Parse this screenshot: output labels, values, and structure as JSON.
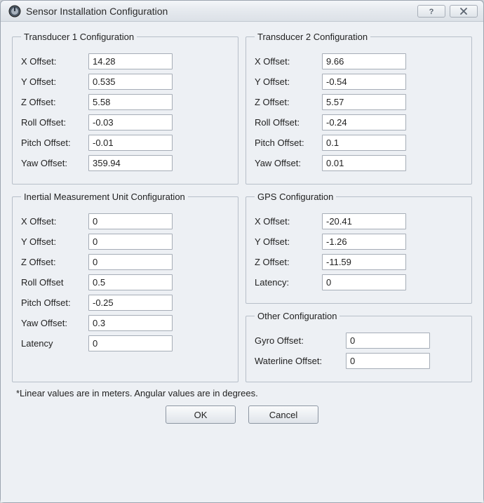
{
  "window": {
    "title": "Sensor Installation Configuration"
  },
  "groups": {
    "t1": {
      "legend": "Transducer 1 Configuration",
      "x_label": "X Offset:",
      "x_val": "14.28",
      "y_label": "Y Offset:",
      "y_val": "0.535",
      "z_label": "Z Offset:",
      "z_val": "5.58",
      "roll_label": "Roll Offset:",
      "roll_val": "-0.03",
      "pitch_label": "Pitch Offset:",
      "pitch_val": "-0.01",
      "yaw_label": "Yaw Offset:",
      "yaw_val": "359.94"
    },
    "t2": {
      "legend": "Transducer 2 Configuration",
      "x_label": "X Offset:",
      "x_val": "9.66",
      "y_label": "Y Offset:",
      "y_val": "-0.54",
      "z_label": "Z Offset:",
      "z_val": "5.57",
      "roll_label": "Roll Offset:",
      "roll_val": "-0.24",
      "pitch_label": "Pitch Offset:",
      "pitch_val": "0.1",
      "yaw_label": "Yaw Offset:",
      "yaw_val": "0.01"
    },
    "imu": {
      "legend": "Inertial Measurement Unit Configuration",
      "x_label": "X Offset:",
      "x_val": "0",
      "y_label": "Y Offset:",
      "y_val": "0",
      "z_label": "Z Offset:",
      "z_val": "0",
      "roll_label": "Roll Offset",
      "roll_val": "0.5",
      "pitch_label": "Pitch Offset:",
      "pitch_val": "-0.25",
      "yaw_label": "Yaw Offset:",
      "yaw_val": "0.3",
      "lat_label": "Latency",
      "lat_val": "0"
    },
    "gps": {
      "legend": "GPS Configuration",
      "x_label": "X Offset:",
      "x_val": "-20.41",
      "y_label": "Y Offset:",
      "y_val": "-1.26",
      "z_label": "Z Offset:",
      "z_val": "-11.59",
      "lat_label": "Latency:",
      "lat_val": "0"
    },
    "other": {
      "legend": "Other Configuration",
      "gyro_label": "Gyro Offset:",
      "gyro_val": "0",
      "wl_label": "Waterline Offset:",
      "wl_val": "0"
    }
  },
  "note": "*Linear values are in meters.  Angular values are in degrees.",
  "buttons": {
    "ok": "OK",
    "cancel": "Cancel"
  }
}
